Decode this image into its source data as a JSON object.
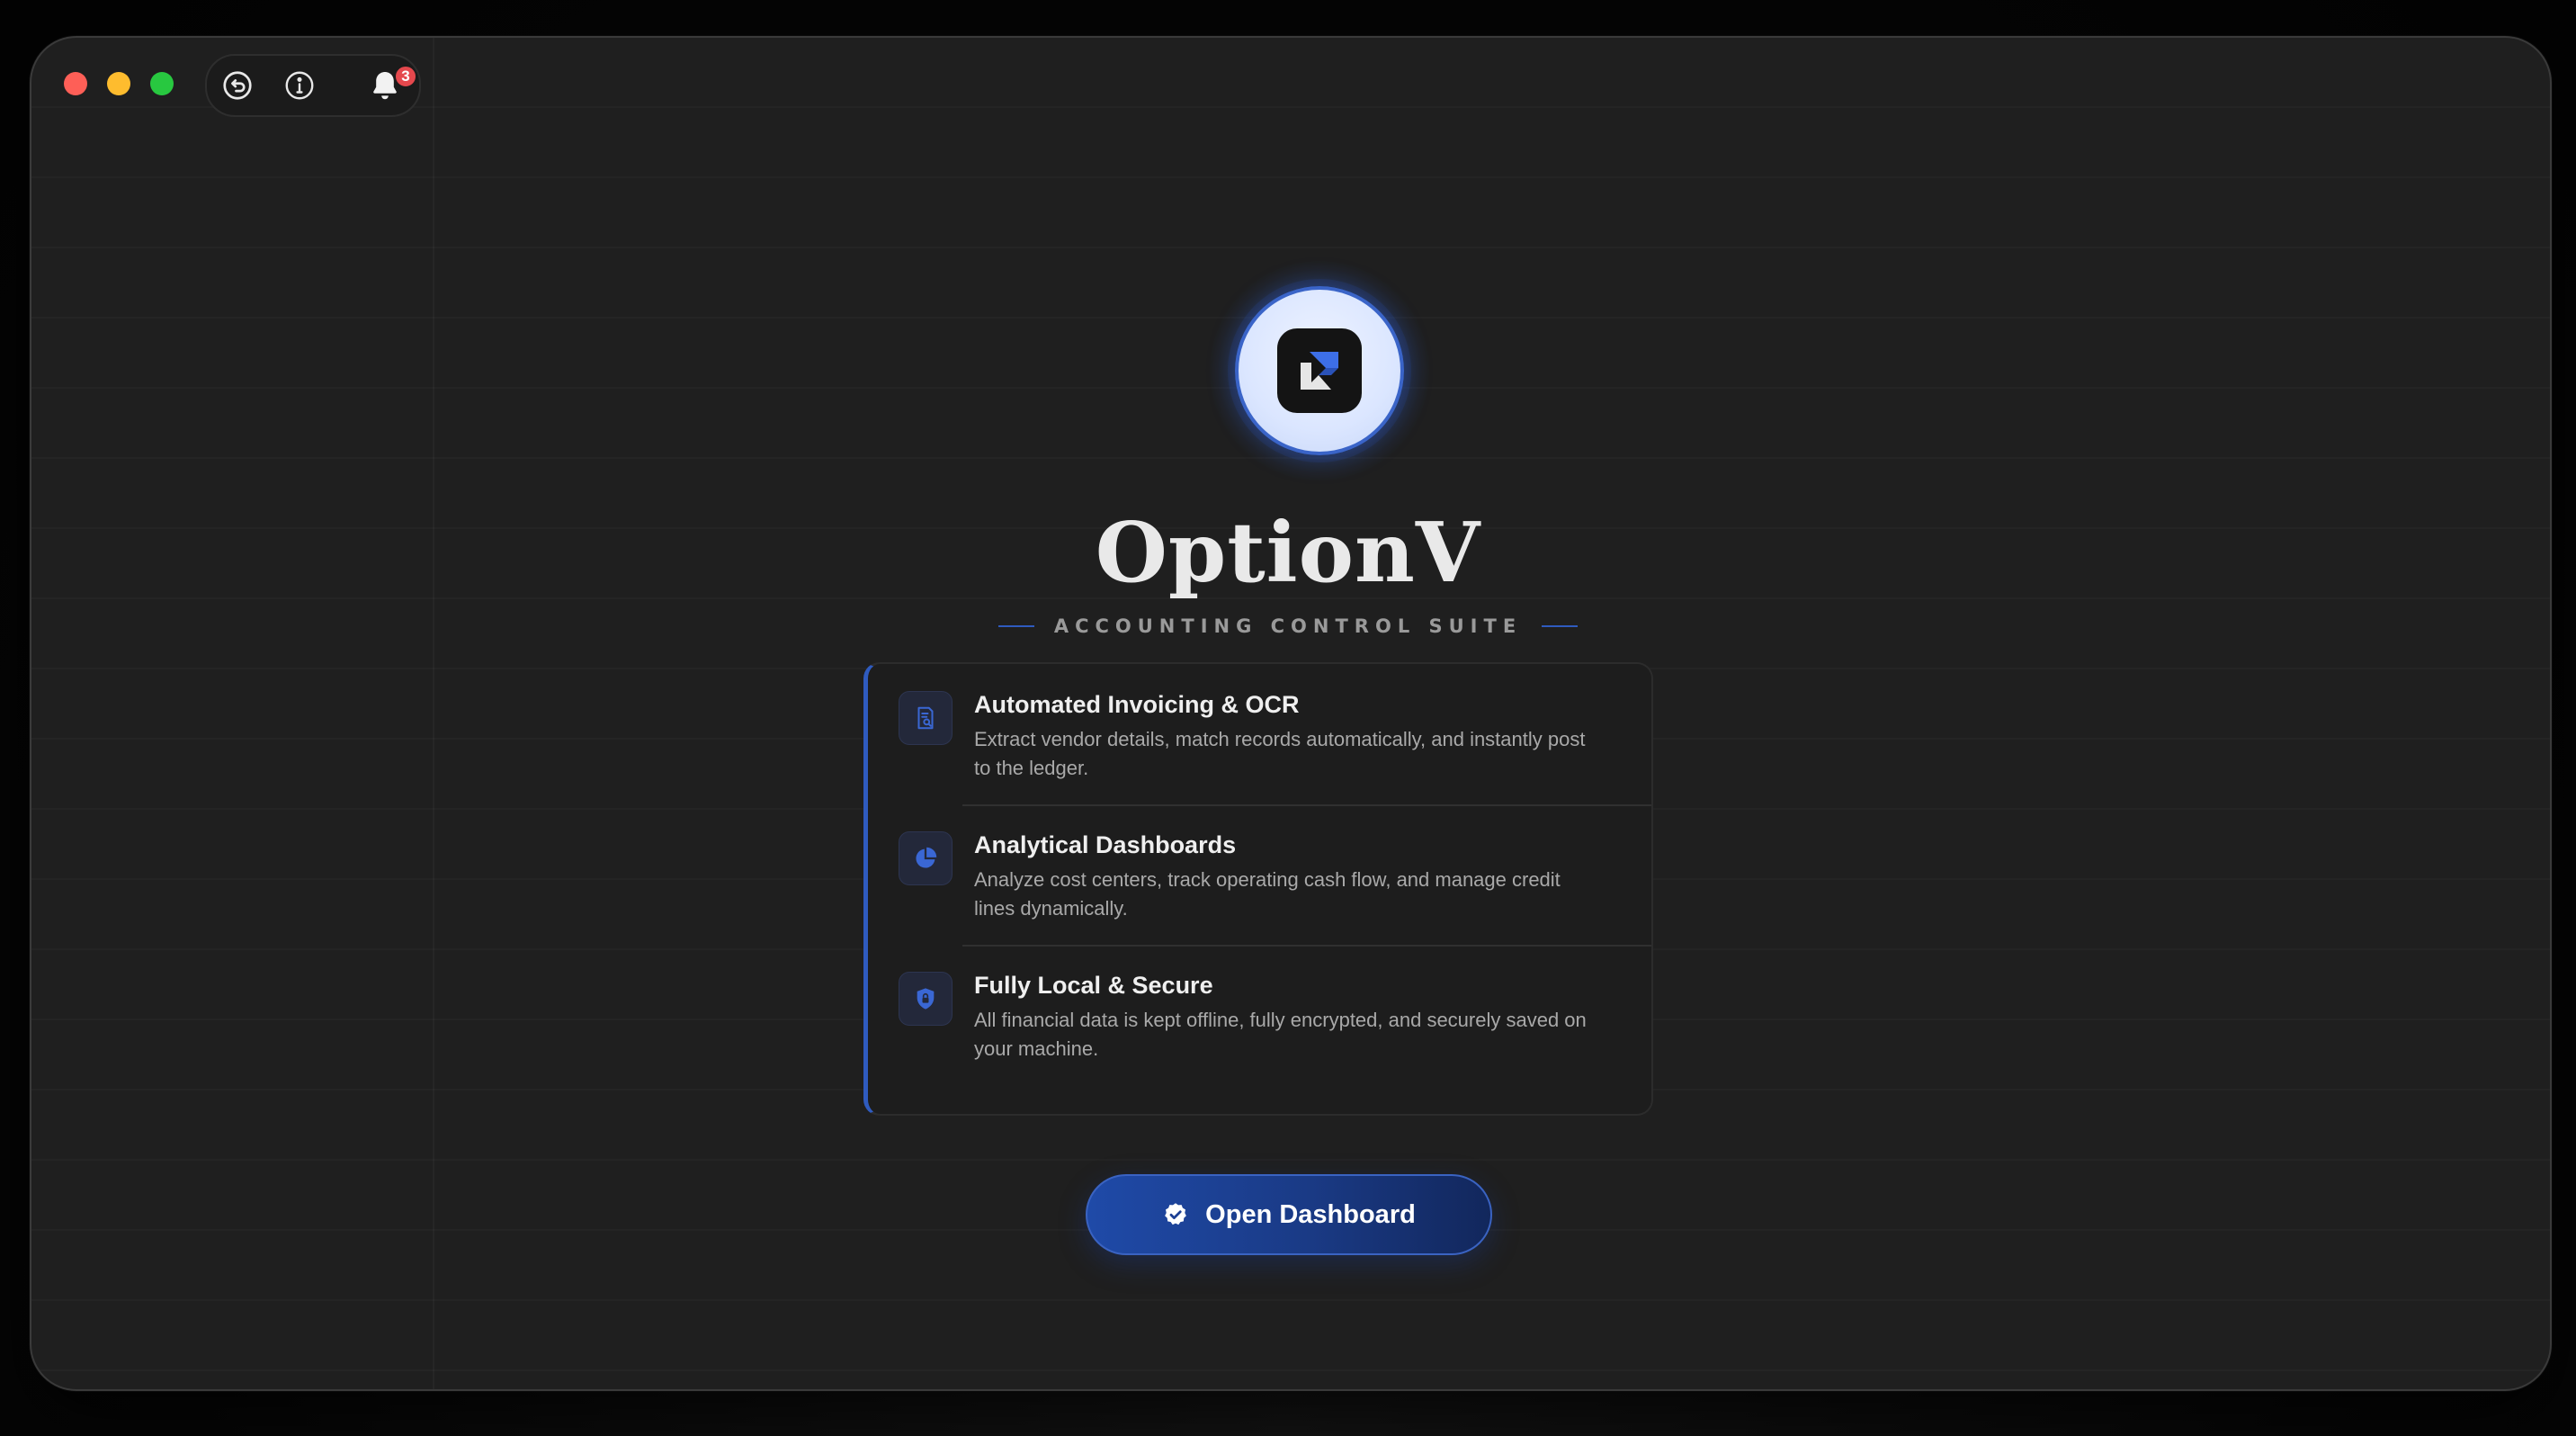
{
  "window": {
    "notifications_count": "3"
  },
  "brand": {
    "name": "OptionV",
    "tagline": "ACCOUNTING CONTROL SUITE",
    "accent_color": "#2f5bbf"
  },
  "features": [
    {
      "icon": "document-search-icon",
      "title": "Automated Invoicing & OCR",
      "description": "Extract vendor details, match records automatically, and instantly post to the ledger."
    },
    {
      "icon": "pie-chart-icon",
      "title": "Analytical Dashboards",
      "description": "Analyze cost centers, track operating cash flow, and manage credit lines dynamically."
    },
    {
      "icon": "shield-lock-icon",
      "title": "Fully Local & Secure",
      "description": "All financial data is kept offline, fully encrypted, and securely saved on your machine."
    }
  ],
  "cta": {
    "label": "Open Dashboard",
    "icon": "check-badge-icon"
  }
}
